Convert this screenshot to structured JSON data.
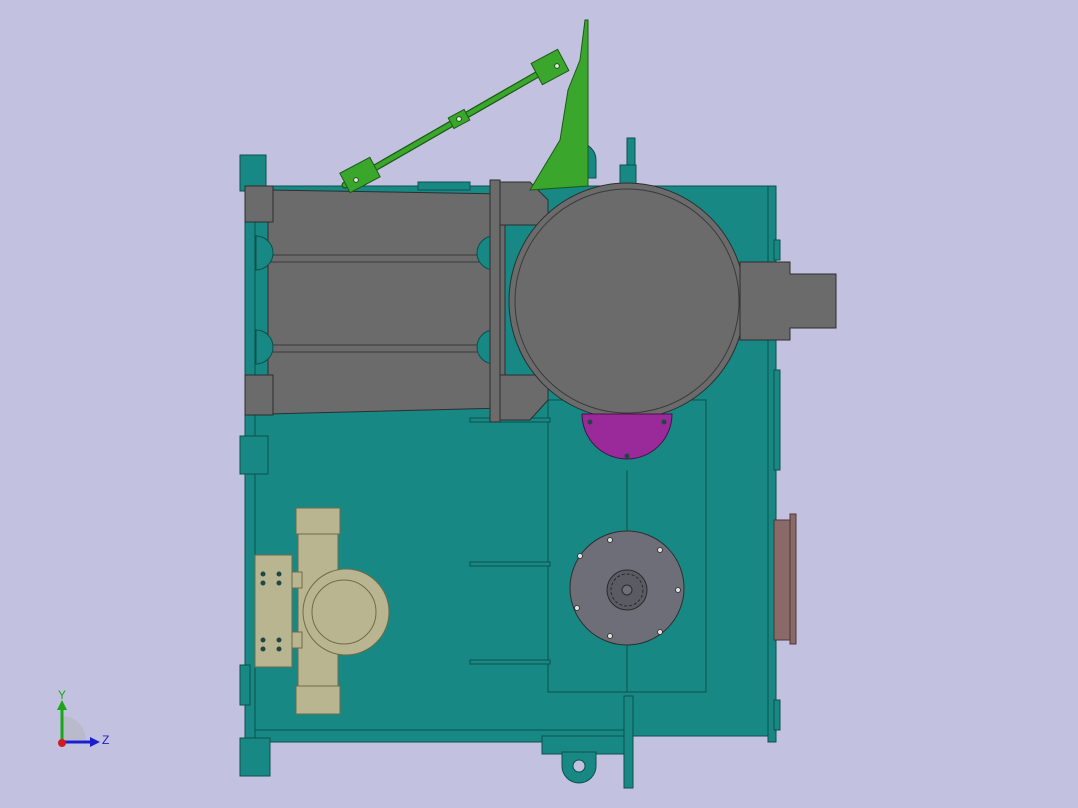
{
  "viewport": {
    "background": "#c2c2e0",
    "triad": {
      "y_label": "Y",
      "z_label": "Z"
    }
  },
  "colors": {
    "housing": "#178884",
    "housing_edge": "#0e4f4c",
    "gray_part": "#6b6b6b",
    "disk": "#6e6e78",
    "brace": "#3aa62c",
    "flange": "#9a2a9a",
    "pipe": "#b8b590",
    "side_plate": "#8a6a68",
    "axis_y": "#1aa51a",
    "axis_z": "#1c1cd0",
    "axis_x": "#d01c1c"
  }
}
